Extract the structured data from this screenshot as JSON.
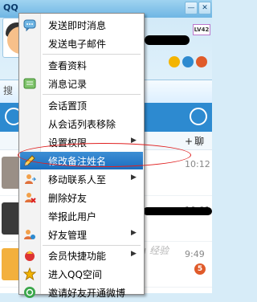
{
  "window": {
    "app_logo": "QQ",
    "minimize_glyph": "—",
    "close_glyph": "✕",
    "level_badge": "LV42"
  },
  "sidebar": {
    "search_label": "搜"
  },
  "chat_list": {
    "chat_button": "聊天",
    "plus": "+",
    "rows": [
      {
        "time": "10:12"
      },
      {
        "time": "10:01"
      },
      {
        "time": "9:49"
      }
    ],
    "unread_badge": "5"
  },
  "context_menu": {
    "items": [
      {
        "label": "发送即时消息",
        "icon": "chat-bubble-icon",
        "submenu": false
      },
      {
        "label": "发送电子邮件",
        "icon": "",
        "submenu": false
      },
      {
        "label": "查看资料",
        "icon": "",
        "submenu": false
      },
      {
        "label": "消息记录",
        "icon": "message-log-icon",
        "submenu": false
      },
      {
        "label": "会话置顶",
        "icon": "",
        "submenu": false
      },
      {
        "label": "从会话列表移除",
        "icon": "",
        "submenu": false
      },
      {
        "label": "设置权限",
        "icon": "",
        "submenu": true
      },
      {
        "label": "修改备注姓名",
        "icon": "edit-pencil-icon",
        "submenu": false
      },
      {
        "label": "移动联系人至",
        "icon": "move-contact-icon",
        "submenu": true
      },
      {
        "label": "删除好友",
        "icon": "delete-friend-icon",
        "submenu": false
      },
      {
        "label": "举报此用户",
        "icon": "",
        "submenu": false
      },
      {
        "label": "好友管理",
        "icon": "friend-manage-icon",
        "submenu": true
      },
      {
        "label": "会员快捷功能",
        "icon": "vip-icon",
        "submenu": true
      },
      {
        "label": "进入QQ空间",
        "icon": "qzone-star-icon",
        "submenu": false
      },
      {
        "label": "邀请好友开通微博",
        "icon": "weibo-icon",
        "submenu": false
      }
    ],
    "submenu_arrow": "▶"
  },
  "watermark": "Baidu 经验",
  "colors": {
    "highlight": "#1a6ebf",
    "ellipse": "#e02020",
    "tabbar": "#2d8ad0"
  }
}
